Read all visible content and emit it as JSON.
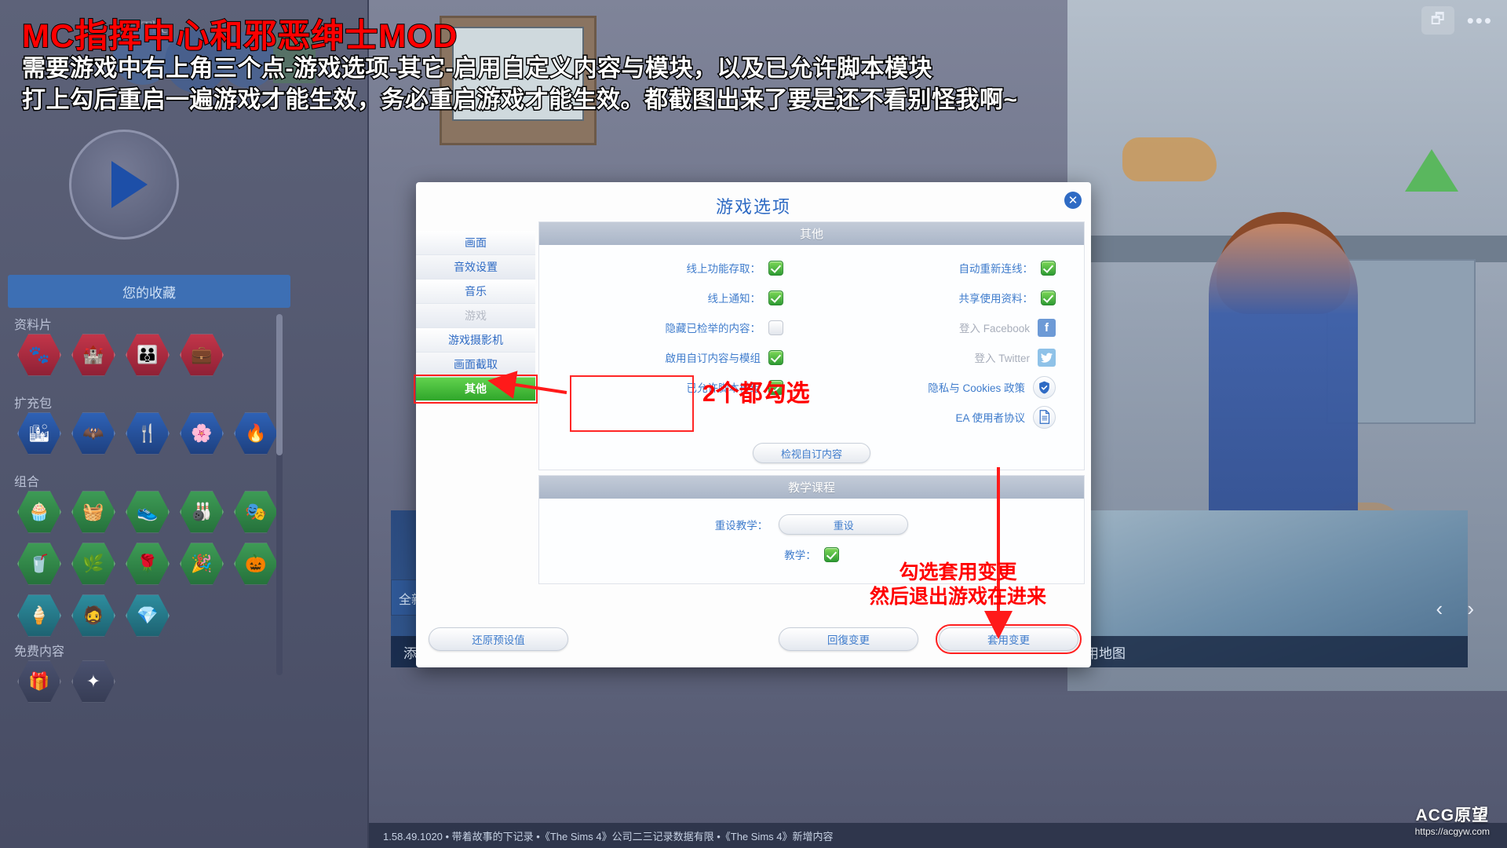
{
  "annotation": {
    "title": "MC指挥中心和邪恶绅士MOD",
    "line1": "需要游戏中右上角三个点-游戏选项-其它-启用自定义内容与模块，以及已允许脚本模块",
    "line2": "打上勾后重启一遍游戏才能生效，务必重启游戏才能生效。都截图出来了要是还不看别怪我啊~",
    "callout_two": "2个都勾选",
    "callout_apply_line1": "勾选套用变更",
    "callout_apply_line2": "然后退出游戏在进来"
  },
  "dialog": {
    "title": "游戏选项",
    "close_icon": "close-icon",
    "sidebar": [
      {
        "label": "画面",
        "state": "normal"
      },
      {
        "label": "音效设置",
        "state": "normal"
      },
      {
        "label": "音乐",
        "state": "normal"
      },
      {
        "label": "游戏",
        "state": "disabled"
      },
      {
        "label": "游戏摄影机",
        "state": "normal"
      },
      {
        "label": "画面截取",
        "state": "normal"
      },
      {
        "label": "其他",
        "state": "active"
      }
    ],
    "panels": [
      {
        "header": "其他",
        "left_rows": [
          {
            "label": "线上功能存取：",
            "control": "checkbox",
            "checked": true
          },
          {
            "label": "线上通知：",
            "control": "checkbox",
            "checked": true
          },
          {
            "label": "隐藏已检举的内容：",
            "control": "checkbox",
            "checked": false
          },
          {
            "label": "啟用自订内容与模组",
            "control": "checkbox",
            "checked": true
          },
          {
            "label": "已允许脚本模组",
            "control": "checkbox",
            "checked": true
          }
        ],
        "right_rows": [
          {
            "label": "自动重新连线：",
            "control": "checkbox",
            "checked": true
          },
          {
            "label": "共享使用资料：",
            "control": "checkbox",
            "checked": true
          },
          {
            "label": "登入 Facebook",
            "control": "facebook-icon",
            "glyph": "f",
            "dim": true
          },
          {
            "label": "登入 Twitter",
            "control": "twitter-icon",
            "glyph": "t",
            "dim": true
          },
          {
            "label": "隐私与 Cookies 政策",
            "control": "shield-icon",
            "glyph": "◈",
            "dim": false
          },
          {
            "label": "EA 使用者协议",
            "control": "document-icon",
            "glyph": "▤",
            "dim": false
          }
        ],
        "button": "检视自订内容"
      },
      {
        "header": "教学课程",
        "rows": [
          {
            "label": "重设教学：",
            "control": "button",
            "button_label": "重设"
          },
          {
            "label": "教学：",
            "control": "checkbox",
            "checked": true
          }
        ]
      }
    ],
    "footer": {
      "restore_defaults": "还原预设值",
      "revert_changes": "回復变更",
      "apply_changes": "套用变更"
    }
  },
  "background": {
    "favorites_label": "您的收藏",
    "sections": [
      {
        "label": "资料片"
      },
      {
        "label": "扩充包"
      },
      {
        "label": "组合"
      },
      {
        "label": "免费内容"
      }
    ],
    "tiles": [
      {
        "caption": "添加至您的动能"
      },
      {
        "caption": "使用地图"
      }
    ],
    "tile_header": "全新",
    "status_text": "1.58.49.1020 • 带着故事的下记录  •《The Sims 4》公司二三记录数据有限 •《The Sims 4》新增内容"
  },
  "watermark": {
    "main": "ACG原望",
    "sub": "https://acgyw.com"
  },
  "colors": {
    "accent_blue": "#2f6bc4",
    "active_green": "#3fb133",
    "annotation_red": "#ff0000",
    "panel_header": "#aab6c8"
  }
}
